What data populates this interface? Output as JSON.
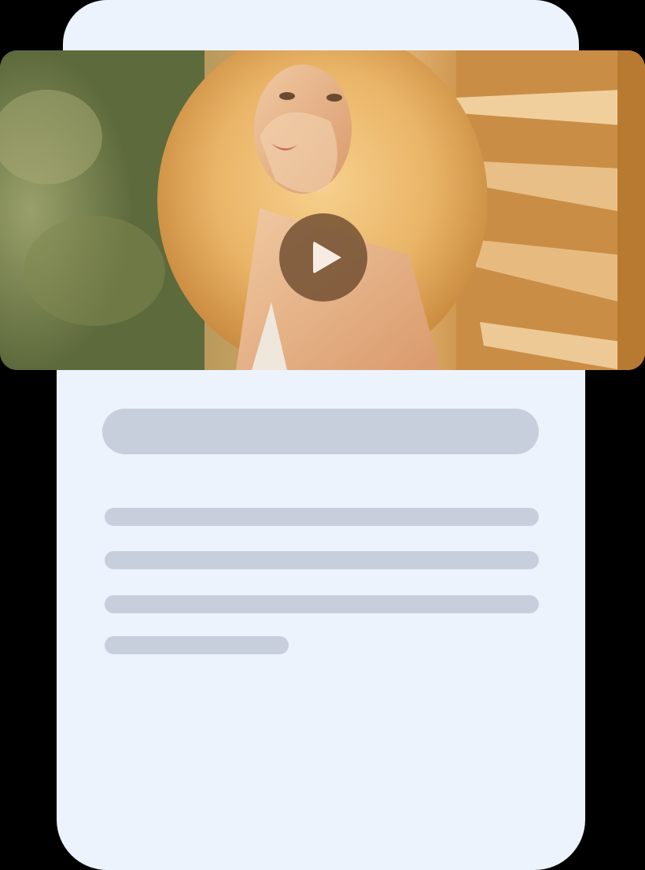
{
  "colors": {
    "card_background": "#edf3fd",
    "skeleton": "#c8cfdc",
    "page_background": "#000000",
    "play_button": "#6e4c30"
  },
  "video": {
    "thumbnail": "woman-with-blonde-curly-hair-by-wooden-shutters",
    "play_icon": "play-icon"
  },
  "content": {
    "title_placeholder": "loading-skeleton",
    "text_lines": 4
  }
}
